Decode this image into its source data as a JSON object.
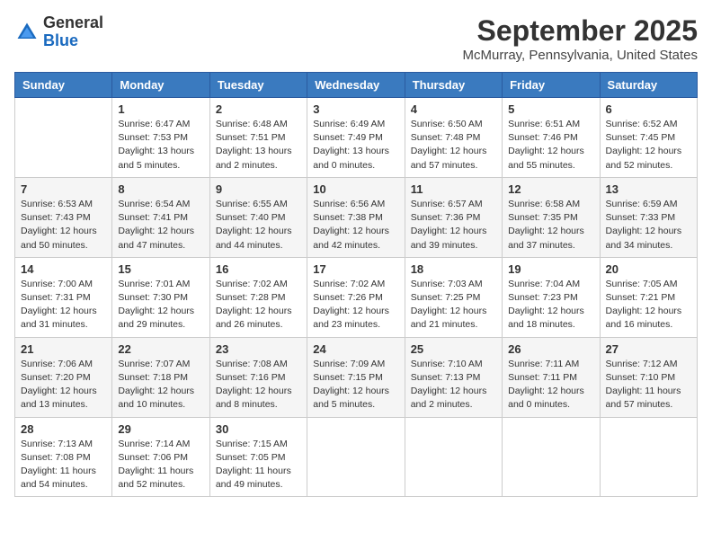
{
  "header": {
    "logo_line1": "General",
    "logo_line2": "Blue",
    "month": "September 2025",
    "location": "McMurray, Pennsylvania, United States"
  },
  "weekdays": [
    "Sunday",
    "Monday",
    "Tuesday",
    "Wednesday",
    "Thursday",
    "Friday",
    "Saturday"
  ],
  "weeks": [
    [
      {
        "day": "",
        "info": ""
      },
      {
        "day": "1",
        "info": "Sunrise: 6:47 AM\nSunset: 7:53 PM\nDaylight: 13 hours\nand 5 minutes."
      },
      {
        "day": "2",
        "info": "Sunrise: 6:48 AM\nSunset: 7:51 PM\nDaylight: 13 hours\nand 2 minutes."
      },
      {
        "day": "3",
        "info": "Sunrise: 6:49 AM\nSunset: 7:49 PM\nDaylight: 13 hours\nand 0 minutes."
      },
      {
        "day": "4",
        "info": "Sunrise: 6:50 AM\nSunset: 7:48 PM\nDaylight: 12 hours\nand 57 minutes."
      },
      {
        "day": "5",
        "info": "Sunrise: 6:51 AM\nSunset: 7:46 PM\nDaylight: 12 hours\nand 55 minutes."
      },
      {
        "day": "6",
        "info": "Sunrise: 6:52 AM\nSunset: 7:45 PM\nDaylight: 12 hours\nand 52 minutes."
      }
    ],
    [
      {
        "day": "7",
        "info": "Sunrise: 6:53 AM\nSunset: 7:43 PM\nDaylight: 12 hours\nand 50 minutes."
      },
      {
        "day": "8",
        "info": "Sunrise: 6:54 AM\nSunset: 7:41 PM\nDaylight: 12 hours\nand 47 minutes."
      },
      {
        "day": "9",
        "info": "Sunrise: 6:55 AM\nSunset: 7:40 PM\nDaylight: 12 hours\nand 44 minutes."
      },
      {
        "day": "10",
        "info": "Sunrise: 6:56 AM\nSunset: 7:38 PM\nDaylight: 12 hours\nand 42 minutes."
      },
      {
        "day": "11",
        "info": "Sunrise: 6:57 AM\nSunset: 7:36 PM\nDaylight: 12 hours\nand 39 minutes."
      },
      {
        "day": "12",
        "info": "Sunrise: 6:58 AM\nSunset: 7:35 PM\nDaylight: 12 hours\nand 37 minutes."
      },
      {
        "day": "13",
        "info": "Sunrise: 6:59 AM\nSunset: 7:33 PM\nDaylight: 12 hours\nand 34 minutes."
      }
    ],
    [
      {
        "day": "14",
        "info": "Sunrise: 7:00 AM\nSunset: 7:31 PM\nDaylight: 12 hours\nand 31 minutes."
      },
      {
        "day": "15",
        "info": "Sunrise: 7:01 AM\nSunset: 7:30 PM\nDaylight: 12 hours\nand 29 minutes."
      },
      {
        "day": "16",
        "info": "Sunrise: 7:02 AM\nSunset: 7:28 PM\nDaylight: 12 hours\nand 26 minutes."
      },
      {
        "day": "17",
        "info": "Sunrise: 7:02 AM\nSunset: 7:26 PM\nDaylight: 12 hours\nand 23 minutes."
      },
      {
        "day": "18",
        "info": "Sunrise: 7:03 AM\nSunset: 7:25 PM\nDaylight: 12 hours\nand 21 minutes."
      },
      {
        "day": "19",
        "info": "Sunrise: 7:04 AM\nSunset: 7:23 PM\nDaylight: 12 hours\nand 18 minutes."
      },
      {
        "day": "20",
        "info": "Sunrise: 7:05 AM\nSunset: 7:21 PM\nDaylight: 12 hours\nand 16 minutes."
      }
    ],
    [
      {
        "day": "21",
        "info": "Sunrise: 7:06 AM\nSunset: 7:20 PM\nDaylight: 12 hours\nand 13 minutes."
      },
      {
        "day": "22",
        "info": "Sunrise: 7:07 AM\nSunset: 7:18 PM\nDaylight: 12 hours\nand 10 minutes."
      },
      {
        "day": "23",
        "info": "Sunrise: 7:08 AM\nSunset: 7:16 PM\nDaylight: 12 hours\nand 8 minutes."
      },
      {
        "day": "24",
        "info": "Sunrise: 7:09 AM\nSunset: 7:15 PM\nDaylight: 12 hours\nand 5 minutes."
      },
      {
        "day": "25",
        "info": "Sunrise: 7:10 AM\nSunset: 7:13 PM\nDaylight: 12 hours\nand 2 minutes."
      },
      {
        "day": "26",
        "info": "Sunrise: 7:11 AM\nSunset: 7:11 PM\nDaylight: 12 hours\nand 0 minutes."
      },
      {
        "day": "27",
        "info": "Sunrise: 7:12 AM\nSunset: 7:10 PM\nDaylight: 11 hours\nand 57 minutes."
      }
    ],
    [
      {
        "day": "28",
        "info": "Sunrise: 7:13 AM\nSunset: 7:08 PM\nDaylight: 11 hours\nand 54 minutes."
      },
      {
        "day": "29",
        "info": "Sunrise: 7:14 AM\nSunset: 7:06 PM\nDaylight: 11 hours\nand 52 minutes."
      },
      {
        "day": "30",
        "info": "Sunrise: 7:15 AM\nSunset: 7:05 PM\nDaylight: 11 hours\nand 49 minutes."
      },
      {
        "day": "",
        "info": ""
      },
      {
        "day": "",
        "info": ""
      },
      {
        "day": "",
        "info": ""
      },
      {
        "day": "",
        "info": ""
      }
    ]
  ]
}
